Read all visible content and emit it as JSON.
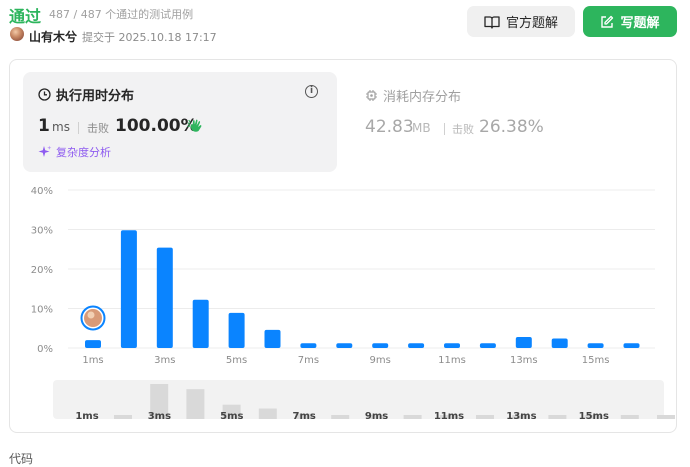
{
  "header": {
    "status": "通过",
    "tests_passed": "487 / 487 个通过的测试用例",
    "author": "山有木兮",
    "submitted": "提交于 2025.10.18 17:17",
    "official_solution_label": "官方题解",
    "write_solution_label": "写题解",
    "accent_green": "#2db55d"
  },
  "runtime": {
    "title": "执行用时分布",
    "value": "1",
    "unit": "ms",
    "beat_label": "击败",
    "beat_value": "100.00%",
    "complexity_label": "复杂度分析"
  },
  "memory": {
    "title": "消耗内存分布",
    "value": "42.83",
    "unit": "MB",
    "beat_label": "击败",
    "beat_value": "26.38%"
  },
  "chart_data": {
    "type": "bar",
    "x": [
      1,
      2,
      3,
      4,
      5,
      6,
      7,
      8,
      9,
      10,
      11,
      12,
      13,
      14,
      15,
      16
    ],
    "values": [
      2,
      29.8,
      25.4,
      12.2,
      8.9,
      4.6,
      1.2,
      1.2,
      1.2,
      1.2,
      1.2,
      1.2,
      2.8,
      2.4,
      1.2,
      1.2
    ],
    "ylim": [
      0,
      40
    ],
    "yticks": [
      "0%",
      "10%",
      "20%",
      "30%",
      "40%"
    ],
    "xticks": [
      "1ms",
      "3ms",
      "5ms",
      "7ms",
      "9ms",
      "11ms",
      "13ms",
      "15ms"
    ],
    "overview_xticks": [
      "1ms",
      "3ms",
      "5ms",
      "7ms",
      "9ms",
      "11ms",
      "13ms",
      "15ms"
    ],
    "highlight_index": 0,
    "grid": true,
    "bar_color": "#0a84ff",
    "overview_bar_color": "#d9d9d9"
  },
  "footer": {
    "code_label": "代码"
  }
}
